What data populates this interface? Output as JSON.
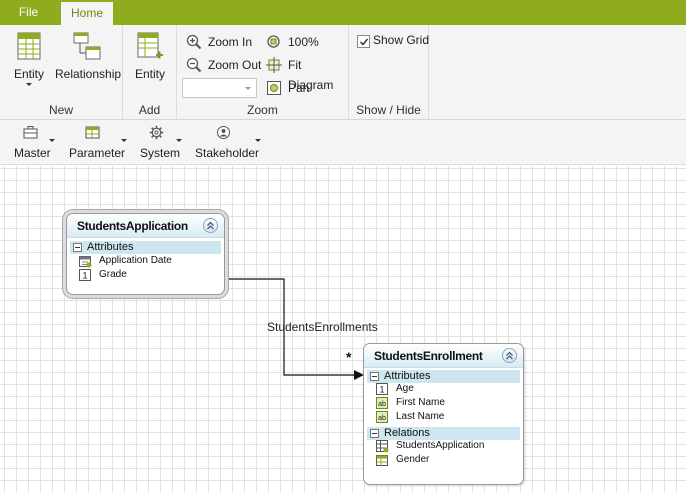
{
  "menu": {
    "file": "File",
    "home": "Home"
  },
  "ribbon": {
    "new_group": {
      "label": "New",
      "entity": "Entity",
      "relationship": "Relationship"
    },
    "add_group": {
      "label": "Add",
      "entity": "Entity"
    },
    "zoom_group": {
      "label": "Zoom",
      "zoom_in": "Zoom In",
      "zoom_out": "Zoom Out",
      "hundred": "100%",
      "fit": "Fit Diagram",
      "pan": "Pan",
      "zoom_value": ""
    },
    "showhide_group": {
      "label": "Show / Hide",
      "show_grid": "Show Grid",
      "show_grid_checked": true
    }
  },
  "toolbar": {
    "items": [
      {
        "label": "Master",
        "icon": "briefcase-icon"
      },
      {
        "label": "Parameter",
        "icon": "table-icon"
      },
      {
        "label": "System",
        "icon": "gear-icon"
      },
      {
        "label": "Stakeholder",
        "icon": "stakeholder-icon"
      }
    ]
  },
  "diagram": {
    "entities": [
      {
        "title": "StudentsApplication",
        "sections": [
          {
            "label": "Attributes",
            "rows": [
              {
                "label": "Application Date",
                "icon": "calendar-icon"
              },
              {
                "label": "Grade",
                "icon": "number-icon"
              }
            ]
          }
        ]
      },
      {
        "title": "StudentsEnrollment",
        "sections": [
          {
            "label": "Attributes",
            "rows": [
              {
                "label": "Age",
                "icon": "number-icon"
              },
              {
                "label": "First Name",
                "icon": "text-icon"
              },
              {
                "label": "Last Name",
                "icon": "text-icon"
              }
            ]
          },
          {
            "label": "Relations",
            "rows": [
              {
                "label": "StudentsApplication",
                "icon": "relation-entity-icon"
              },
              {
                "label": "Gender",
                "icon": "relation-table-icon"
              }
            ]
          }
        ]
      }
    ],
    "connector": {
      "label": "StudentsEnrollments",
      "multiplicity": "*"
    }
  },
  "colors": {
    "accent": "#8fac1e",
    "entity_header": "#d8ecf5",
    "section_header": "#cde6ef"
  }
}
